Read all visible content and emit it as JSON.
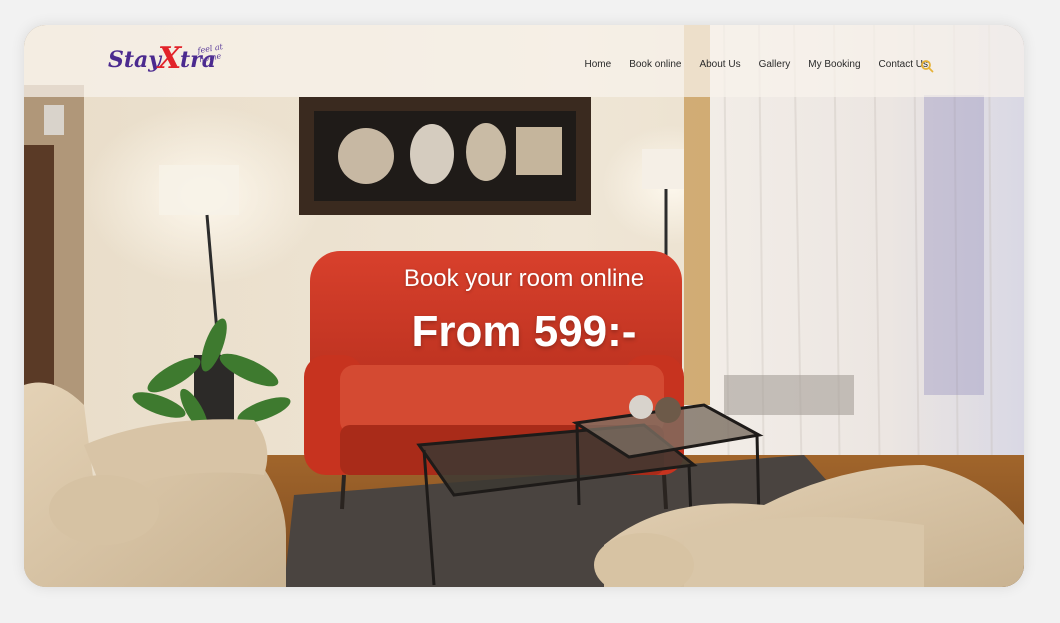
{
  "brand": {
    "logo_stay": "Stay",
    "logo_x": "X",
    "logo_tra": "tra",
    "logo_tagline": "feel at home",
    "colors": {
      "purple": "#4b2a8f",
      "red": "#e2232a",
      "accent": "#e6b238"
    }
  },
  "nav": {
    "items": [
      {
        "label": "Home"
      },
      {
        "label": "Book online"
      },
      {
        "label": "About Us"
      },
      {
        "label": "Gallery"
      },
      {
        "label": "My Booking"
      },
      {
        "label": "Contact Us"
      }
    ],
    "search_icon": "search-icon"
  },
  "hero": {
    "title": "Book your room online",
    "price": "From 599:-"
  }
}
